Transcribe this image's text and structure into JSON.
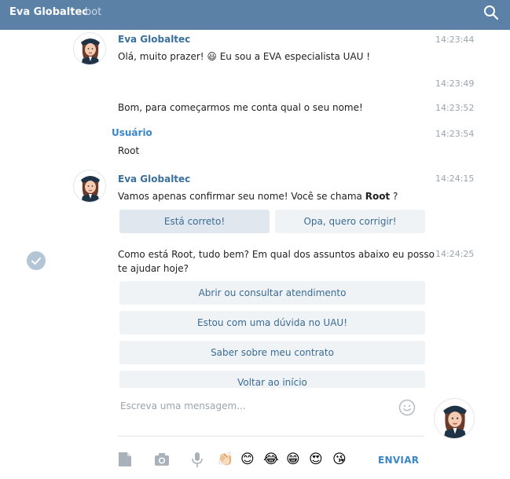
{
  "header": {
    "title": "Eva Globaltec",
    "subtitle": "bot",
    "search_icon": "search-icon"
  },
  "messages": [
    {
      "sender": "Eva Globaltec",
      "text": "Olá, muito prazer! 😃 Eu sou a EVA especialista UAU !",
      "time": "14:23:44"
    },
    {
      "text": "",
      "time": "14:23:49"
    },
    {
      "text": "Bom, para começarmos me conta qual o seu nome!",
      "time": "14:23:52"
    },
    {
      "sender": "Usuário",
      "text": "Root",
      "time": "14:23:54"
    },
    {
      "sender": "Eva Globaltec",
      "text_before": "Vamos apenas confirmar seu nome! Você se chama ",
      "text_bold": "Root",
      "text_after": " ?",
      "time": "14:24:15"
    },
    {
      "text_line1": "Como está Root, tudo bem?  Em qual dos assuntos abaixo eu posso",
      "text_line2": "te ajudar hoje?",
      "time": "14:24:25"
    }
  ],
  "confirm_buttons": [
    "Está correto!",
    "Opa, quero corrigir!"
  ],
  "topic_buttons": [
    "Abrir ou consultar atendimento",
    "Estou com uma dúvida no UAU!",
    "Saber sobre meu contrato",
    "Voltar ao início"
  ],
  "composer": {
    "placeholder": "Escreva uma mensagem...",
    "send_label": "ENVIAR",
    "emojis": [
      "👏🏻",
      "😊",
      "😂",
      "😁",
      "😍",
      "😘"
    ],
    "tools": [
      "attach-file-icon",
      "camera-icon",
      "microphone-icon"
    ]
  },
  "colors": {
    "header": "#5b81a6",
    "name": "#3b6f9b",
    "user_name": "#3a86c8",
    "button_bg": "#f0f3f5",
    "button_text": "#3a6c95"
  }
}
